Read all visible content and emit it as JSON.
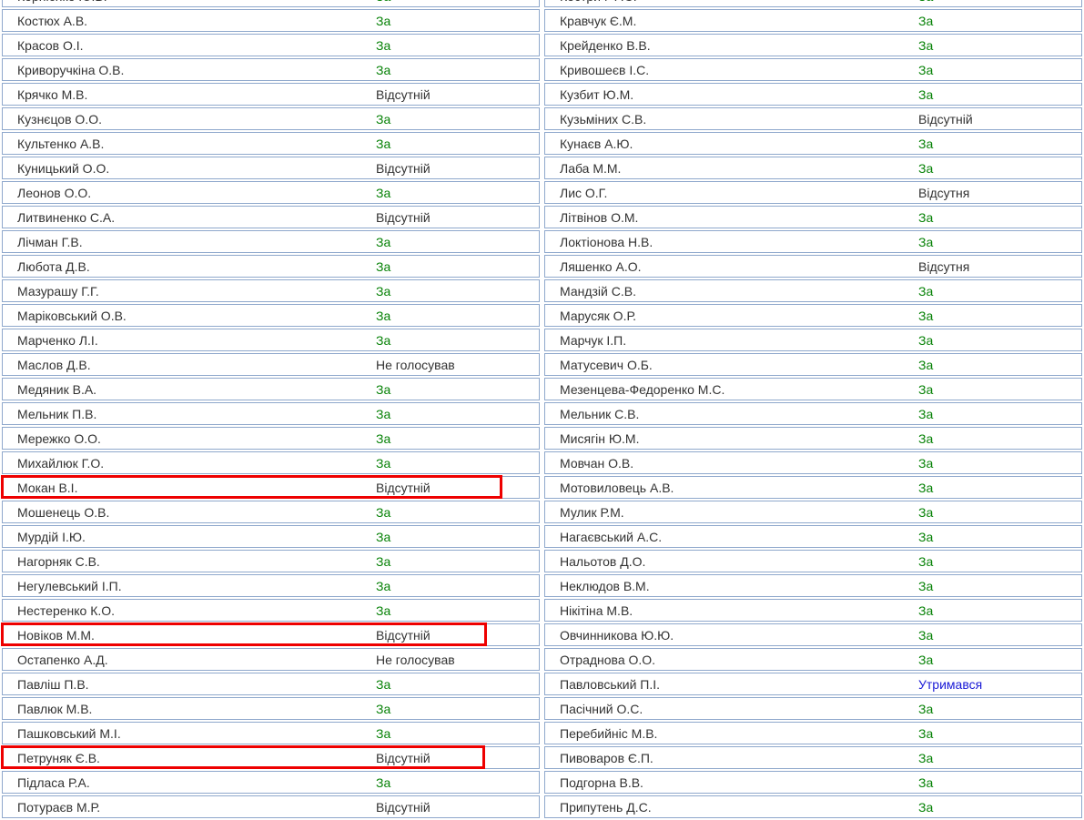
{
  "colors": {
    "vote_for": "#078207",
    "vote_abstain": "#1a1ad6",
    "vote_absent": "#333333",
    "row_border": "#8fa8cc",
    "highlight": "#ee0000"
  },
  "left_rows": [
    {
      "name": "Корнієнко Ю.В.",
      "vote": "За",
      "cls": "za"
    },
    {
      "name": "Костюх А.В.",
      "vote": "За",
      "cls": "za"
    },
    {
      "name": "Красов О.І.",
      "vote": "За",
      "cls": "za"
    },
    {
      "name": "Криворучкіна О.В.",
      "vote": "За",
      "cls": "za"
    },
    {
      "name": "Крячко М.В.",
      "vote": "Відсутній",
      "cls": "abs"
    },
    {
      "name": "Кузнєцов О.О.",
      "vote": "За",
      "cls": "za"
    },
    {
      "name": "Культенко А.В.",
      "vote": "За",
      "cls": "za"
    },
    {
      "name": "Куницький О.О.",
      "vote": "Відсутній",
      "cls": "abs"
    },
    {
      "name": "Леонов О.О.",
      "vote": "За",
      "cls": "za"
    },
    {
      "name": "Литвиненко С.А.",
      "vote": "Відсутній",
      "cls": "abs"
    },
    {
      "name": "Лічман Г.В.",
      "vote": "За",
      "cls": "za"
    },
    {
      "name": "Любота Д.В.",
      "vote": "За",
      "cls": "za"
    },
    {
      "name": "Мазурашу Г.Г.",
      "vote": "За",
      "cls": "za"
    },
    {
      "name": "Маріковський О.В.",
      "vote": "За",
      "cls": "za"
    },
    {
      "name": "Марченко Л.І.",
      "vote": "За",
      "cls": "za"
    },
    {
      "name": "Маслов Д.В.",
      "vote": "Не голосував",
      "cls": "nv"
    },
    {
      "name": "Медяник В.А.",
      "vote": "За",
      "cls": "za"
    },
    {
      "name": "Мельник П.В.",
      "vote": "За",
      "cls": "za"
    },
    {
      "name": "Мережко О.О.",
      "vote": "За",
      "cls": "za"
    },
    {
      "name": "Михайлюк Г.О.",
      "vote": "За",
      "cls": "za"
    },
    {
      "name": "Мокан В.І.",
      "vote": "Відсутній",
      "cls": "abs",
      "highlight": true
    },
    {
      "name": "Мошенець О.В.",
      "vote": "За",
      "cls": "za"
    },
    {
      "name": "Мурдій І.Ю.",
      "vote": "За",
      "cls": "za"
    },
    {
      "name": "Нагорняк С.В.",
      "vote": "За",
      "cls": "za"
    },
    {
      "name": "Негулевський І.П.",
      "vote": "За",
      "cls": "za"
    },
    {
      "name": "Нестеренко К.О.",
      "vote": "За",
      "cls": "za"
    },
    {
      "name": "Новіков М.М.",
      "vote": "Відсутній",
      "cls": "abs",
      "highlight": true
    },
    {
      "name": "Остапенко А.Д.",
      "vote": "Не голосував",
      "cls": "nv"
    },
    {
      "name": "Павліш П.В.",
      "vote": "За",
      "cls": "za"
    },
    {
      "name": "Павлюк М.В.",
      "vote": "За",
      "cls": "za"
    },
    {
      "name": "Пашковський М.І.",
      "vote": "За",
      "cls": "za"
    },
    {
      "name": "Петруняк Є.В.",
      "vote": "Відсутній",
      "cls": "abs",
      "highlight": true
    },
    {
      "name": "Підласа Р.А.",
      "vote": "За",
      "cls": "za"
    },
    {
      "name": "Потураєв М.Р.",
      "vote": "Відсутній",
      "cls": "abs"
    }
  ],
  "right_rows": [
    {
      "name": "Кострич Ф.С.",
      "vote": "За",
      "cls": "za"
    },
    {
      "name": "Кравчук Є.М.",
      "vote": "За",
      "cls": "za"
    },
    {
      "name": "Крейденко В.В.",
      "vote": "За",
      "cls": "za"
    },
    {
      "name": "Кривошеєв І.С.",
      "vote": "За",
      "cls": "za"
    },
    {
      "name": "Кузбит Ю.М.",
      "vote": "За",
      "cls": "za"
    },
    {
      "name": "Кузьміних С.В.",
      "vote": "Відсутній",
      "cls": "abs"
    },
    {
      "name": "Кунаєв А.Ю.",
      "vote": "За",
      "cls": "za"
    },
    {
      "name": "Лаба М.М.",
      "vote": "За",
      "cls": "za"
    },
    {
      "name": "Лис О.Г.",
      "vote": "Відсутня",
      "cls": "abs"
    },
    {
      "name": "Літвінов О.М.",
      "vote": "За",
      "cls": "za"
    },
    {
      "name": "Локтіонова Н.В.",
      "vote": "За",
      "cls": "za"
    },
    {
      "name": "Ляшенко А.О.",
      "vote": "Відсутня",
      "cls": "abs"
    },
    {
      "name": "Мандзій С.В.",
      "vote": "За",
      "cls": "za"
    },
    {
      "name": "Марусяк О.Р.",
      "vote": "За",
      "cls": "za"
    },
    {
      "name": "Марчук І.П.",
      "vote": "За",
      "cls": "za"
    },
    {
      "name": "Матусевич О.Б.",
      "vote": "За",
      "cls": "za"
    },
    {
      "name": "Мезенцева-Федоренко М.С.",
      "vote": "За",
      "cls": "za"
    },
    {
      "name": "Мельник С.В.",
      "vote": "За",
      "cls": "za"
    },
    {
      "name": "Мисягін Ю.М.",
      "vote": "За",
      "cls": "za"
    },
    {
      "name": "Мовчан О.В.",
      "vote": "За",
      "cls": "za"
    },
    {
      "name": "Мотовиловець А.В.",
      "vote": "За",
      "cls": "za"
    },
    {
      "name": "Мулик Р.М.",
      "vote": "За",
      "cls": "za"
    },
    {
      "name": "Нагаєвський А.С.",
      "vote": "За",
      "cls": "za"
    },
    {
      "name": "Нальотов Д.О.",
      "vote": "За",
      "cls": "za"
    },
    {
      "name": "Неклюдов В.М.",
      "vote": "За",
      "cls": "za"
    },
    {
      "name": "Нікітіна М.В.",
      "vote": "За",
      "cls": "za"
    },
    {
      "name": "Овчинникова Ю.Ю.",
      "vote": "За",
      "cls": "za"
    },
    {
      "name": "Отраднова О.О.",
      "vote": "За",
      "cls": "za"
    },
    {
      "name": "Павловський П.І.",
      "vote": "Утримався",
      "cls": "utr"
    },
    {
      "name": "Пасічний О.С.",
      "vote": "За",
      "cls": "za"
    },
    {
      "name": "Перебийніс М.В.",
      "vote": "За",
      "cls": "za"
    },
    {
      "name": "Пивоваров Є.П.",
      "vote": "За",
      "cls": "za"
    },
    {
      "name": "Подгорна В.В.",
      "vote": "За",
      "cls": "za"
    },
    {
      "name": "Припутень Д.С.",
      "vote": "За",
      "cls": "za"
    }
  ]
}
